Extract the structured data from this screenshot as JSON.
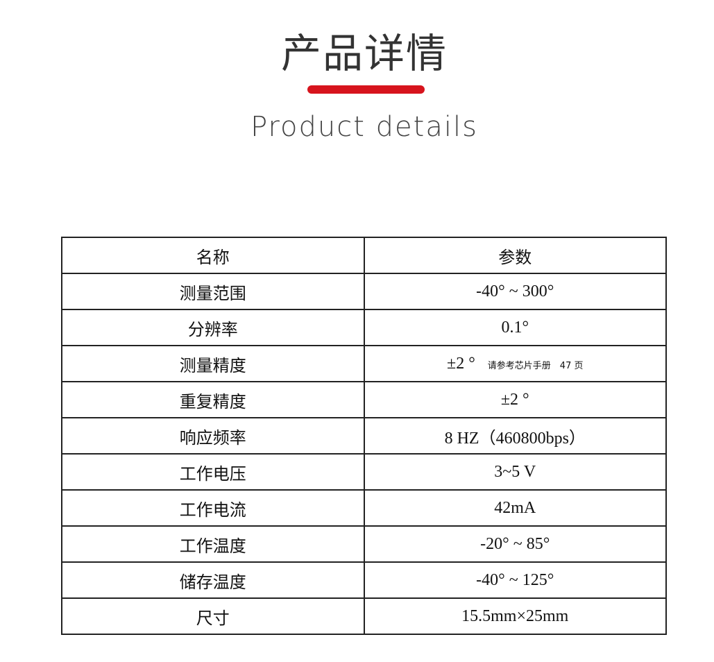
{
  "header": {
    "title_cn": "产品详情",
    "title_en": "Product details",
    "accent": "#d7141d"
  },
  "table": {
    "headers": [
      "名称",
      "参数"
    ],
    "rows": [
      {
        "name": "测量范围",
        "value": "-40° ~ 300°"
      },
      {
        "name": "分辨率",
        "value": "0.1°"
      },
      {
        "name": "测量精度",
        "value": "±2 °",
        "note": "请参考芯片手册　47 页"
      },
      {
        "name": "重复精度",
        "value": "±2 °"
      },
      {
        "name": "响应频率",
        "value": "8 HZ（460800bps）"
      },
      {
        "name": "工作电压",
        "value": "3~5 V"
      },
      {
        "name": "工作电流",
        "value": "42mA"
      },
      {
        "name": "工作温度",
        "value": "-20° ~ 85°"
      },
      {
        "name": "储存温度",
        "value": "-40° ~ 125°"
      },
      {
        "name": "尺寸",
        "value": "15.5mm×25mm"
      }
    ]
  }
}
